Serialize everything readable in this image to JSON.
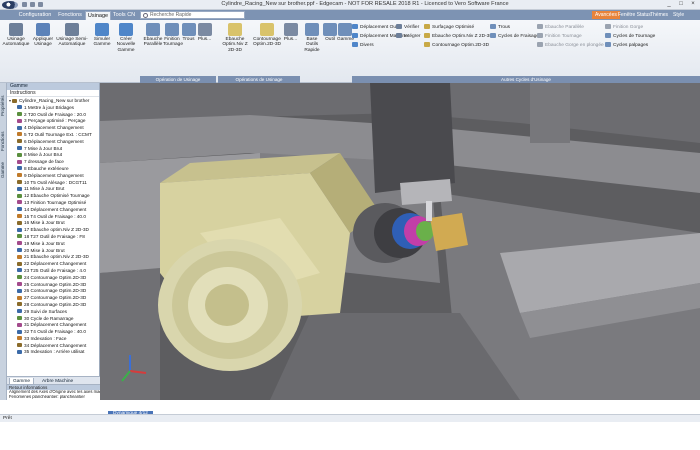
{
  "window": {
    "title": "Cylindre_Racing_New sur brother.ppf - Edgecam - NOT FOR RESALE 2018 R1 - Licenced to Vero Software France",
    "controls": [
      "_",
      "□",
      "×"
    ]
  },
  "tabs": {
    "items": [
      "Configuration",
      "Fonctions",
      "Usinage",
      "Tools CN"
    ],
    "active": "Usinage",
    "search_placeholder": "Recherche Rapide",
    "right": [
      "Avancées",
      "Fenêtre Status",
      "Thèmes",
      "Style"
    ]
  },
  "ribbon": {
    "big_buttons": [
      {
        "label": "Usinage Automatique",
        "color": "#6d7f99"
      },
      {
        "label": "Appliquer Usinage",
        "color": "#5b82b9"
      },
      {
        "label": "Usinage Semi-Automatique",
        "color": "#6d7f99"
      },
      {
        "label": "Simuler Gamme",
        "color": "#4f86c9"
      },
      {
        "label": "Créer Nouvelle Gamme",
        "color": "#4f86c9"
      },
      {
        "label": "Ebauche Parallèle",
        "color": "#6f8fba"
      },
      {
        "label": "Finition Tournage",
        "color": "#6f8fba"
      },
      {
        "label": "Trous",
        "color": "#6f8fba"
      },
      {
        "label": "Plus...",
        "color": "#7b8aa2"
      },
      {
        "label": "Ebauche Optim.Niv Z 2D-3D",
        "color": "#d9c36b"
      },
      {
        "label": "Contournage Optim.2D-3D",
        "color": "#d9c36b"
      },
      {
        "label": "Plus...",
        "color": "#7b8aa2"
      },
      {
        "label": "Base Outils Rapide",
        "color": "#6f8fba"
      },
      {
        "label": "Outil",
        "color": "#6f8fba"
      },
      {
        "label": "Gamme",
        "color": "#6f8fba"
      }
    ],
    "groups": [
      "Opération de Usinage",
      "Opérations de Usinage",
      "Autres Cycles d'Usinage"
    ],
    "small_commands": [
      {
        "label": "Déplacement Outil",
        "color": "#4f86c9"
      },
      {
        "label": "Déplacement Machine",
        "color": "#4f86c9"
      },
      {
        "label": "Divers",
        "color": "#4f86c9"
      },
      {
        "label": "Vérifier",
        "color": "#6d7f99"
      },
      {
        "label": "Intégrer",
        "color": "#6d7f99"
      },
      {
        "label": "Surfaçage Optimisé",
        "color": "#c8a946"
      },
      {
        "label": "Ebauche Optim.Niv Z 2D-3D",
        "color": "#c8a946"
      },
      {
        "label": "Contournage Optim.2D-3D",
        "color": "#c8a946"
      },
      {
        "label": "Trous",
        "color": "#6f8fba"
      },
      {
        "label": "Cycles de Fraisage",
        "color": "#6f8fba"
      },
      {
        "label": "Ebauche Parallèle",
        "color": "#9aa3b0"
      },
      {
        "label": "Finition Tournage",
        "color": "#9aa3b0"
      },
      {
        "label": "Ebauche Gorge en plongée",
        "color": "#9aa3b0"
      },
      {
        "label": "Finition Gorge",
        "color": "#9aa3b0"
      },
      {
        "label": "Cycles de Tournage",
        "color": "#6f8fba"
      },
      {
        "label": "Cycles palpages",
        "color": "#6f8fba"
      }
    ]
  },
  "left_tabs": [
    "Propriétés",
    "Fonctions",
    "Gamme"
  ],
  "panel": {
    "title": "Gamme",
    "header": "Instructions",
    "tree": [
      "Cylindre_Racing_New sur brother",
      "1 Mettre à jour Bridages",
      "2 T20 Outil de Fraisage : 20.0",
      "3 Perçage optimisé : Perçage",
      "4 Déplacement Changement",
      "5 T2 Outil Tournage Ext. : CCMT",
      "6 Déplacement Changement",
      "7 Mise à Jour Brut",
      "8 Mise à Jour Brut",
      "7 dressage de face",
      "8 Ebauche extérieure",
      "9 Déplacement Changement",
      "10 T5 Outil Alésage : DCGT11",
      "11 Mise à Jour Brut",
      "12 Ebauche Optimisé Tournage",
      "13 Finition Tournage Optimisé",
      "14 Déplacement Changement",
      "15 T4 Outil de Fraisage : 40.0",
      "16 Mise à Jour Brut",
      "17 Ebauche optim.Niv Z 2D-3D",
      "18 T27 Outil de Fraisage : F8",
      "19 Mise à Jour Brut",
      "20 Mise à Jour Brut",
      "21 Ebauche optim.Niv Z 2D-3D",
      "22 Déplacement Changement",
      "23 T25 Outil de Fraisage : 4.0",
      "24 Contournage Optim.2D-3D",
      "25 Contournage Optim.2D-3D",
      "26 Contournage Optim.2D-3D",
      "27 Contournage Optim.2D-3D",
      "28 Contournage Optim.2D-3D",
      "29 Suivi de Surfaces",
      "30 Cycle de Ramarrage",
      "31 Déplacement Changement",
      "32 T4 Outil de Fraisage : 40.0",
      "33 Indexation : Face",
      "34 Déplacement Changement",
      "35 Indexation : Arrière utilisat"
    ]
  },
  "panel_tabs": [
    "Gamme",
    "Arbre Machine"
  ],
  "info": {
    "title": "Retour informations",
    "lines": [
      "Alignement des Axes d'Origine avec les axes mac",
      "Fenomènes planchéantier: planchéantier"
    ]
  },
  "viewport": {
    "mode_label": "Dynamique 4/12"
  },
  "status": {
    "text": "Prêt"
  }
}
